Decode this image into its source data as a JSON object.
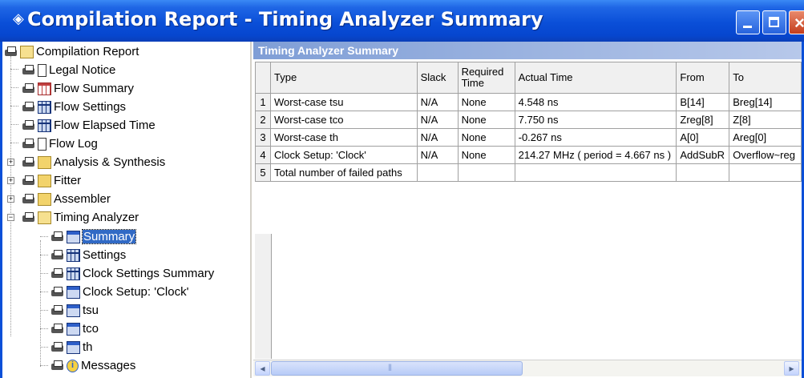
{
  "window": {
    "title": "Compilation Report - Timing Analyzer Summary",
    "app_icon": "quartus-diamond-icon",
    "controls": [
      "minimize",
      "maximize",
      "close"
    ]
  },
  "tree": {
    "items": [
      {
        "label": "Compilation Report",
        "icon": "folder-open-icon"
      },
      {
        "label": "Legal Notice",
        "icon": "document-icon"
      },
      {
        "label": "Flow Summary",
        "icon": "table-red-icon"
      },
      {
        "label": "Flow Settings",
        "icon": "table-icon"
      },
      {
        "label": "Flow Elapsed Time",
        "icon": "table-icon"
      },
      {
        "label": "Flow Log",
        "icon": "document-icon"
      },
      {
        "label": "Analysis & Synthesis",
        "icon": "folder-icon",
        "expander": "+"
      },
      {
        "label": "Fitter",
        "icon": "folder-icon",
        "expander": "+"
      },
      {
        "label": "Assembler",
        "icon": "folder-icon",
        "expander": "+"
      },
      {
        "label": "Timing Analyzer",
        "icon": "folder-open-icon",
        "expander": "−"
      },
      {
        "label": "Summary",
        "icon": "report-icon",
        "selected": true
      },
      {
        "label": "Settings",
        "icon": "table-icon"
      },
      {
        "label": "Clock Settings Summary",
        "icon": "table-icon"
      },
      {
        "label": "Clock Setup: 'Clock'",
        "icon": "report-icon"
      },
      {
        "label": "tsu",
        "icon": "report-icon"
      },
      {
        "label": "tco",
        "icon": "report-icon"
      },
      {
        "label": "th",
        "icon": "report-icon"
      },
      {
        "label": "Messages",
        "icon": "info-icon"
      }
    ]
  },
  "panel": {
    "header": "Timing Analyzer Summary",
    "columns": [
      "Type",
      "Slack",
      "Required Time",
      "Actual Time",
      "From",
      "To"
    ],
    "rows": [
      {
        "idx": "1",
        "type": "Worst-case tsu",
        "slack": "N/A",
        "required": "None",
        "actual": "4.548 ns",
        "from": "B[14]",
        "to": "Breg[14]"
      },
      {
        "idx": "2",
        "type": "Worst-case tco",
        "slack": "N/A",
        "required": "None",
        "actual": "7.750 ns",
        "from": "Zreg[8]",
        "to": "Z[8]"
      },
      {
        "idx": "3",
        "type": "Worst-case th",
        "slack": "N/A",
        "required": "None",
        "actual": "-0.267 ns",
        "from": "A[0]",
        "to": "Areg[0]"
      },
      {
        "idx": "4",
        "type": "Clock Setup: 'Clock'",
        "slack": "N/A",
        "required": "None",
        "actual": "214.27 MHz ( period = 4.667 ns )",
        "from": "AddSubR",
        "to": "Overflow~reg"
      },
      {
        "idx": "5",
        "type": "Total number of failed paths",
        "slack": "",
        "required": "",
        "actual": "",
        "from": "",
        "to": ""
      }
    ]
  },
  "colors": {
    "titlebar": "#0a4fd8",
    "panel_header": "#7f9ed6",
    "selection": "#316ac5"
  }
}
